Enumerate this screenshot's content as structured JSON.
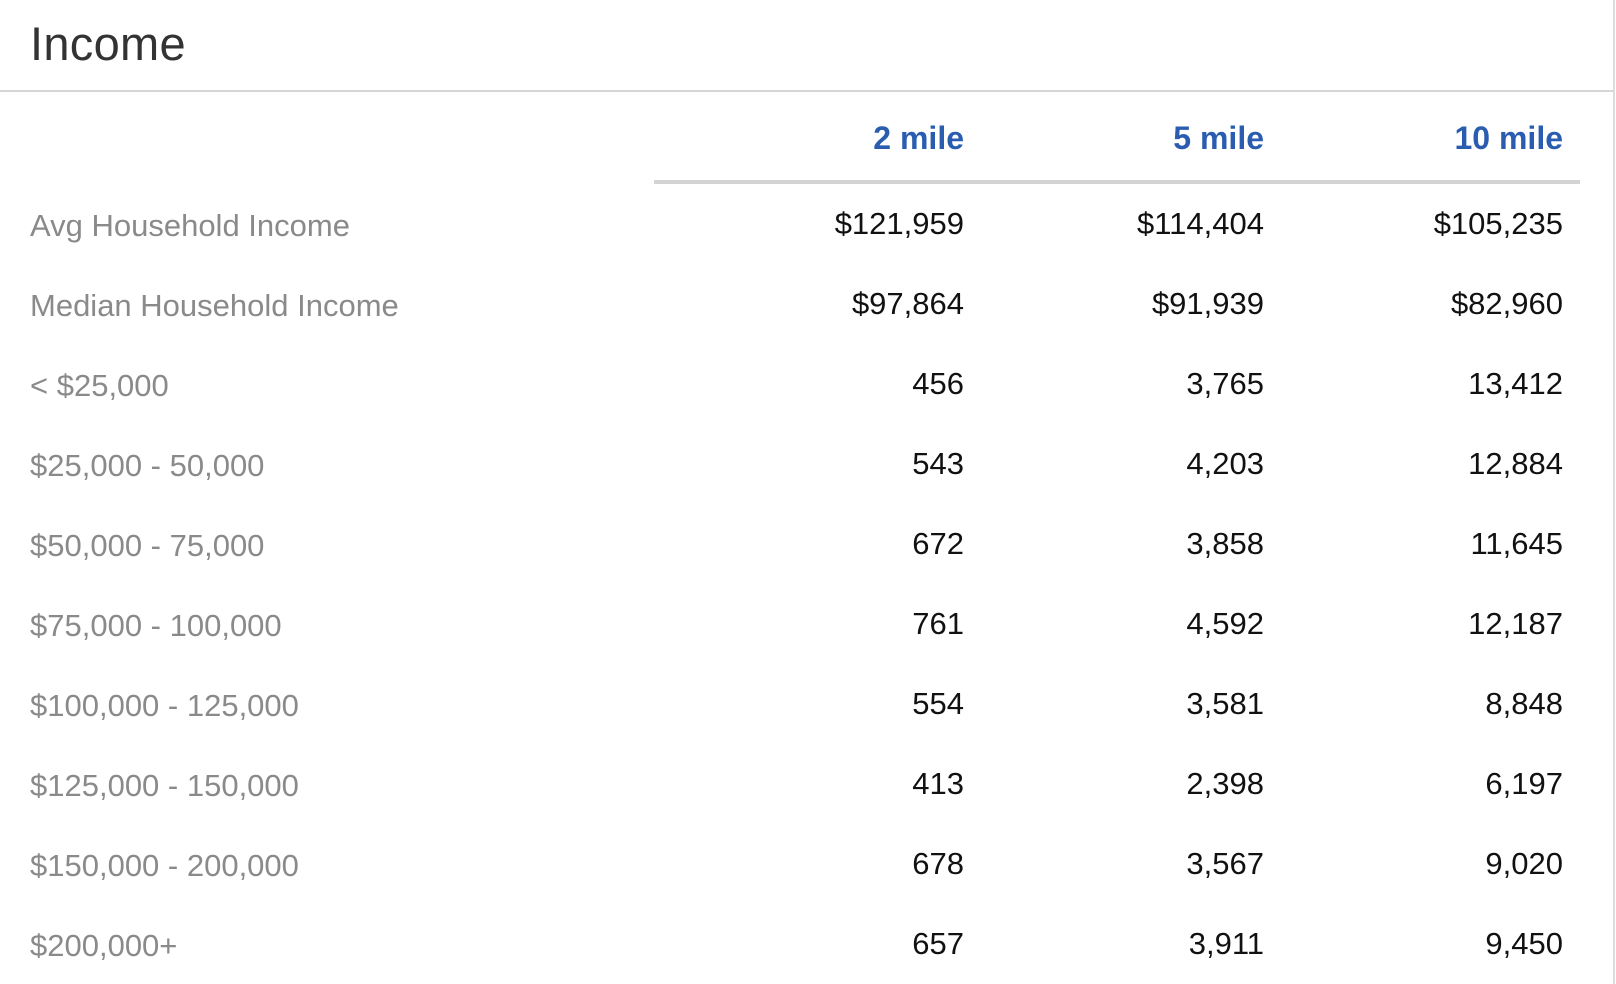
{
  "panel": {
    "title": "Income"
  },
  "table": {
    "columns": [
      "2 mile",
      "5 mile",
      "10 mile"
    ],
    "rows": [
      {
        "label": "Avg Household Income",
        "values": [
          "$121,959",
          "$114,404",
          "$105,235"
        ]
      },
      {
        "label": "Median Household Income",
        "values": [
          "$97,864",
          "$91,939",
          "$82,960"
        ]
      },
      {
        "label": "< $25,000",
        "values": [
          "456",
          "3,765",
          "13,412"
        ]
      },
      {
        "label": "$25,000 - 50,000",
        "values": [
          "543",
          "4,203",
          "12,884"
        ]
      },
      {
        "label": "$50,000 - 75,000",
        "values": [
          "672",
          "3,858",
          "11,645"
        ]
      },
      {
        "label": "$75,000 - 100,000",
        "values": [
          "761",
          "4,592",
          "12,187"
        ]
      },
      {
        "label": "$100,000 - 125,000",
        "values": [
          "554",
          "3,581",
          "8,848"
        ]
      },
      {
        "label": "$125,000 - 150,000",
        "values": [
          "413",
          "2,398",
          "6,197"
        ]
      },
      {
        "label": "$150,000 - 200,000",
        "values": [
          "678",
          "3,567",
          "9,020"
        ]
      },
      {
        "label": "$200,000+",
        "values": [
          "657",
          "3,911",
          "9,450"
        ]
      }
    ]
  },
  "colors": {
    "column_header": "#2a5db0",
    "row_label": "#8a8a8a",
    "value": "#111111",
    "rule": "#d3d3d3"
  }
}
